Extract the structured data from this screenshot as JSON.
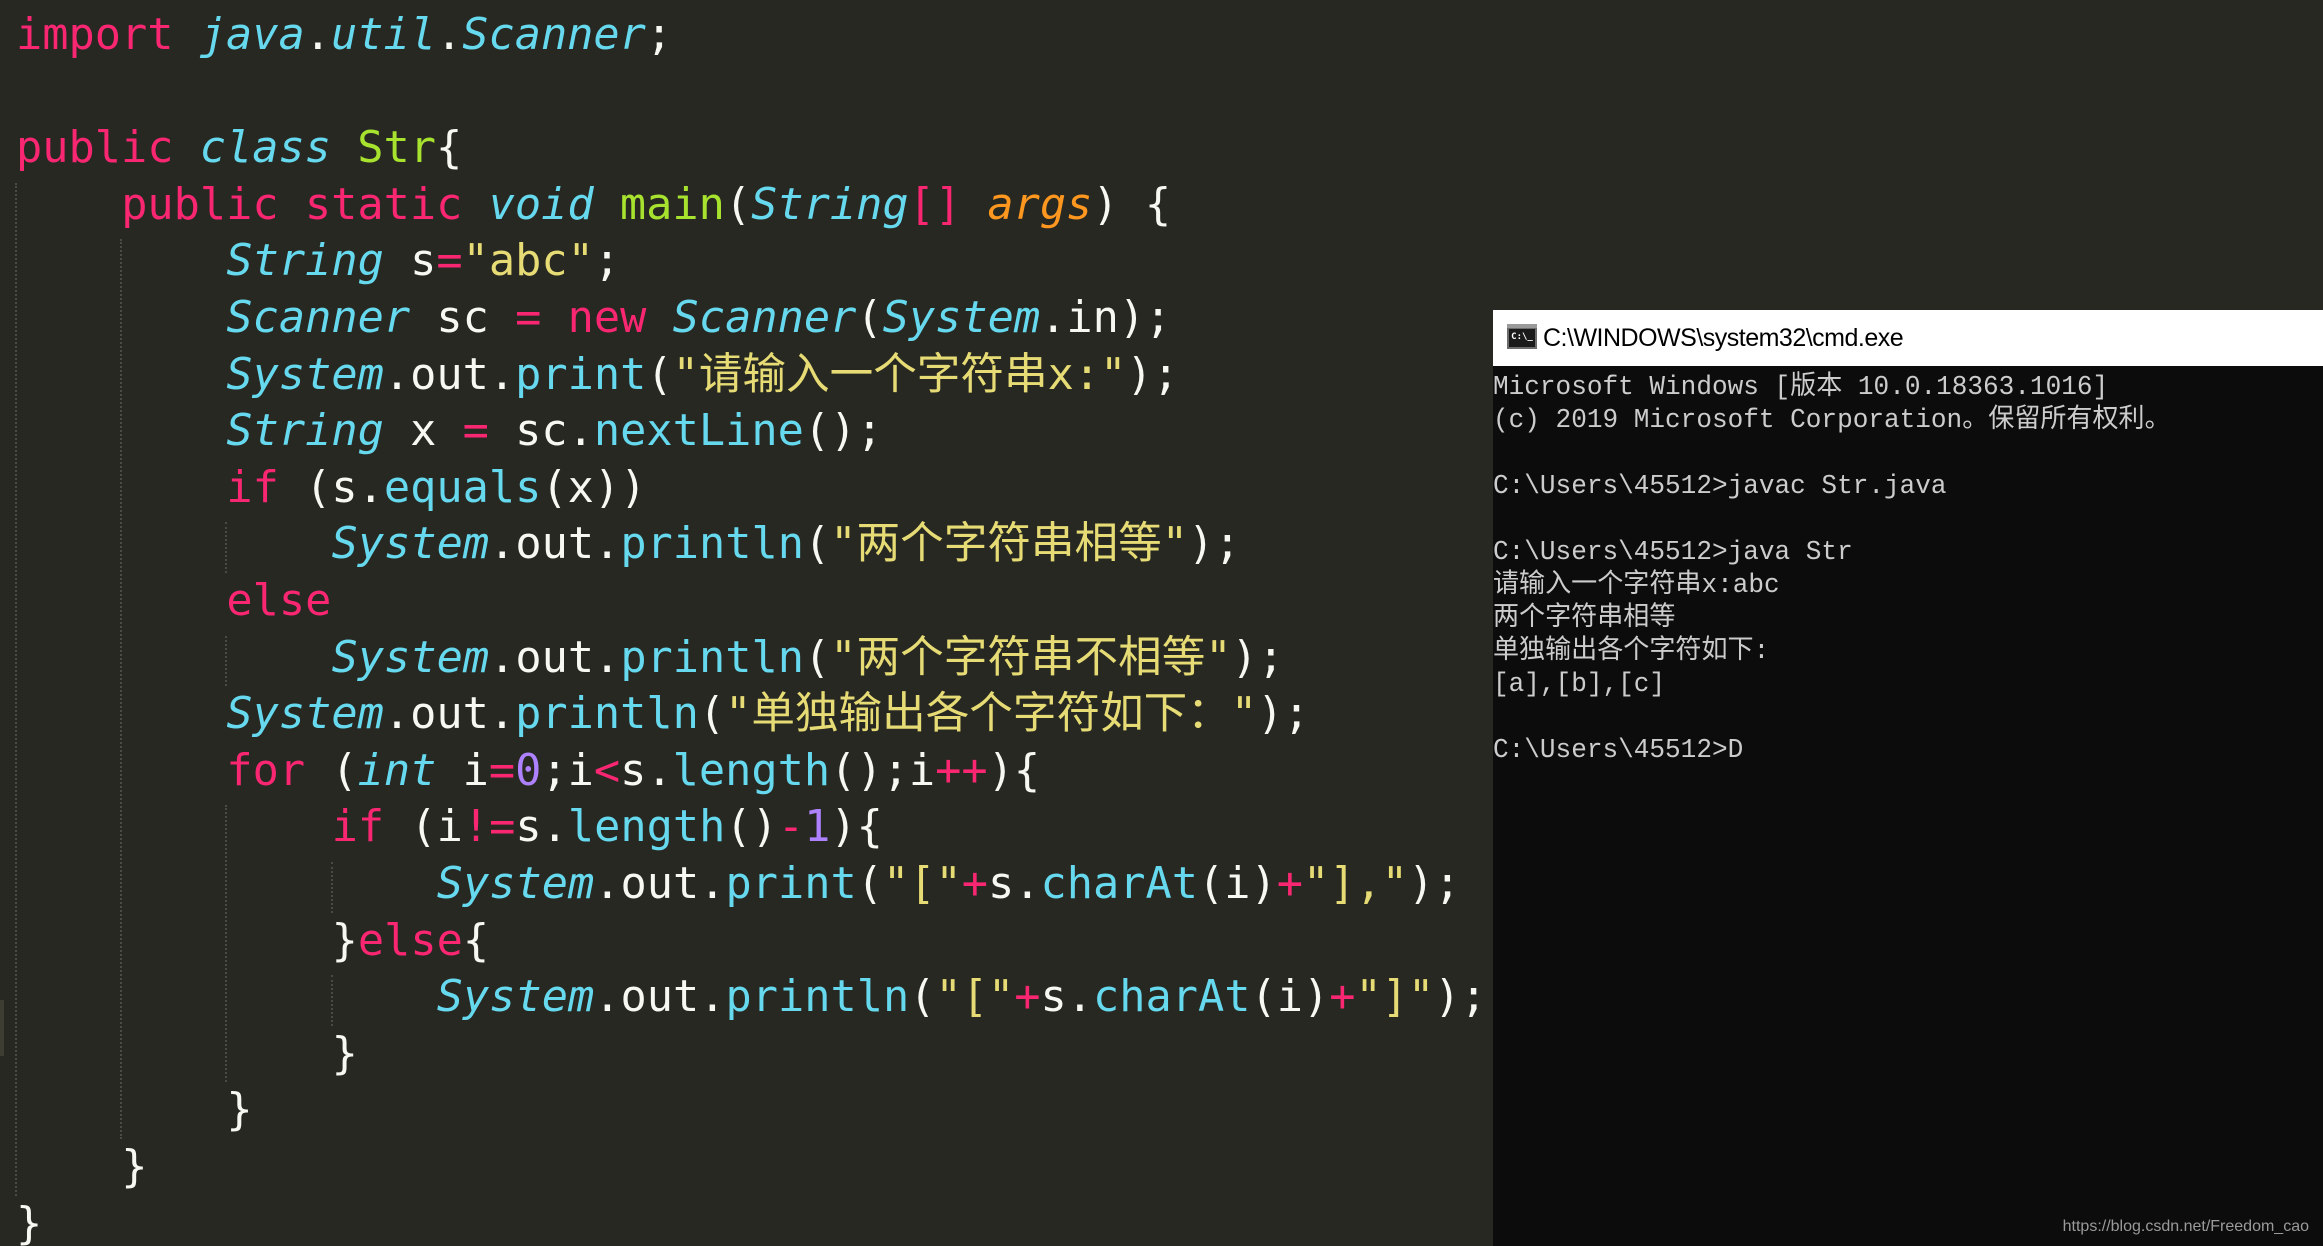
{
  "editor": {
    "theme_colors": {
      "background": "#272822",
      "keyword": "#f92672",
      "type": "#66d9ef",
      "class_name": "#a6e22e",
      "argument": "#fd971f",
      "string": "#e6db74",
      "number": "#ae81ff",
      "text": "#f8f8f2"
    },
    "lines": [
      {
        "indent": 0,
        "tokens": [
          [
            "kw",
            "import"
          ],
          [
            "plain",
            " "
          ],
          [
            "type",
            "java"
          ],
          [
            "plain",
            "."
          ],
          [
            "type",
            "util"
          ],
          [
            "plain",
            "."
          ],
          [
            "type",
            "Scanner"
          ],
          [
            "plain",
            ";"
          ]
        ]
      },
      {
        "indent": 0,
        "tokens": []
      },
      {
        "indent": 0,
        "tokens": [
          [
            "kw",
            "public"
          ],
          [
            "plain",
            " "
          ],
          [
            "type",
            "class"
          ],
          [
            "plain",
            " "
          ],
          [
            "cls",
            "Str"
          ],
          [
            "plain",
            "{"
          ]
        ]
      },
      {
        "indent": 1,
        "tokens": [
          [
            "kw",
            "public"
          ],
          [
            "plain",
            " "
          ],
          [
            "kw",
            "static"
          ],
          [
            "plain",
            " "
          ],
          [
            "type",
            "void"
          ],
          [
            "plain",
            " "
          ],
          [
            "main",
            "main"
          ],
          [
            "plain",
            "("
          ],
          [
            "type",
            "String"
          ],
          [
            "op",
            "[]"
          ],
          [
            "plain",
            " "
          ],
          [
            "arg",
            "args"
          ],
          [
            "plain",
            ") {"
          ]
        ]
      },
      {
        "indent": 2,
        "tokens": [
          [
            "type",
            "String"
          ],
          [
            "plain",
            " s"
          ],
          [
            "op",
            "="
          ],
          [
            "str",
            "\"abc\""
          ],
          [
            "plain",
            ";"
          ]
        ]
      },
      {
        "indent": 2,
        "tokens": [
          [
            "type",
            "Scanner"
          ],
          [
            "plain",
            " sc "
          ],
          [
            "op",
            "="
          ],
          [
            "plain",
            " "
          ],
          [
            "kw",
            "new"
          ],
          [
            "plain",
            " "
          ],
          [
            "type",
            "Scanner"
          ],
          [
            "plain",
            "("
          ],
          [
            "type",
            "System"
          ],
          [
            "plain",
            ".in);"
          ]
        ]
      },
      {
        "indent": 2,
        "tokens": [
          [
            "type",
            "System"
          ],
          [
            "plain",
            ".out."
          ],
          [
            "fn",
            "print"
          ],
          [
            "plain",
            "("
          ],
          [
            "str",
            "\"请输入一个字符串x:\""
          ],
          [
            "plain",
            ");"
          ]
        ]
      },
      {
        "indent": 2,
        "tokens": [
          [
            "type",
            "String"
          ],
          [
            "plain",
            " x "
          ],
          [
            "op",
            "="
          ],
          [
            "plain",
            " sc."
          ],
          [
            "fn",
            "nextLine"
          ],
          [
            "plain",
            "();"
          ]
        ]
      },
      {
        "indent": 2,
        "tokens": [
          [
            "kw",
            "if"
          ],
          [
            "plain",
            " (s."
          ],
          [
            "fn",
            "equals"
          ],
          [
            "plain",
            "(x))"
          ]
        ]
      },
      {
        "indent": 3,
        "tokens": [
          [
            "type",
            "System"
          ],
          [
            "plain",
            ".out."
          ],
          [
            "fn",
            "println"
          ],
          [
            "plain",
            "("
          ],
          [
            "str",
            "\"两个字符串相等\""
          ],
          [
            "plain",
            ");"
          ]
        ]
      },
      {
        "indent": 2,
        "tokens": [
          [
            "kw",
            "else"
          ]
        ]
      },
      {
        "indent": 3,
        "tokens": [
          [
            "type",
            "System"
          ],
          [
            "plain",
            ".out."
          ],
          [
            "fn",
            "println"
          ],
          [
            "plain",
            "("
          ],
          [
            "str",
            "\"两个字符串不相等\""
          ],
          [
            "plain",
            ");"
          ]
        ]
      },
      {
        "indent": 2,
        "tokens": [
          [
            "type",
            "System"
          ],
          [
            "plain",
            ".out."
          ],
          [
            "fn",
            "println"
          ],
          [
            "plain",
            "("
          ],
          [
            "str",
            "\"单独输出各个字符如下：\""
          ],
          [
            "plain",
            ");"
          ]
        ]
      },
      {
        "indent": 2,
        "tokens": [
          [
            "kw",
            "for"
          ],
          [
            "plain",
            " ("
          ],
          [
            "type",
            "int"
          ],
          [
            "plain",
            " i"
          ],
          [
            "op",
            "="
          ],
          [
            "num",
            "0"
          ],
          [
            "plain",
            ";i"
          ],
          [
            "op",
            "<"
          ],
          [
            "plain",
            "s."
          ],
          [
            "fn",
            "length"
          ],
          [
            "plain",
            "();i"
          ],
          [
            "op",
            "++"
          ],
          [
            "plain",
            "){"
          ]
        ]
      },
      {
        "indent": 3,
        "tokens": [
          [
            "kw",
            "if"
          ],
          [
            "plain",
            " (i"
          ],
          [
            "op",
            "!="
          ],
          [
            "plain",
            "s."
          ],
          [
            "fn",
            "length"
          ],
          [
            "plain",
            "()"
          ],
          [
            "op",
            "-"
          ],
          [
            "num",
            "1"
          ],
          [
            "plain",
            "){"
          ]
        ]
      },
      {
        "indent": 4,
        "tokens": [
          [
            "type",
            "System"
          ],
          [
            "plain",
            ".out."
          ],
          [
            "fn",
            "print"
          ],
          [
            "plain",
            "("
          ],
          [
            "str",
            "\"[\""
          ],
          [
            "op",
            "+"
          ],
          [
            "plain",
            "s."
          ],
          [
            "fn",
            "charAt"
          ],
          [
            "plain",
            "(i)"
          ],
          [
            "op",
            "+"
          ],
          [
            "str",
            "\"],\""
          ],
          [
            "plain",
            ");"
          ]
        ]
      },
      {
        "indent": 3,
        "tokens": [
          [
            "plain",
            "}"
          ],
          [
            "kw",
            "else"
          ],
          [
            "plain",
            "{"
          ]
        ]
      },
      {
        "indent": 4,
        "tokens": [
          [
            "type",
            "System"
          ],
          [
            "plain",
            ".out."
          ],
          [
            "fn",
            "println"
          ],
          [
            "plain",
            "("
          ],
          [
            "str",
            "\"[\""
          ],
          [
            "op",
            "+"
          ],
          [
            "plain",
            "s."
          ],
          [
            "fn",
            "charAt"
          ],
          [
            "plain",
            "(i)"
          ],
          [
            "op",
            "+"
          ],
          [
            "str",
            "\"]\""
          ],
          [
            "plain",
            ");"
          ]
        ]
      },
      {
        "indent": 3,
        "tokens": [
          [
            "plain",
            "}"
          ]
        ]
      },
      {
        "indent": 2,
        "tokens": [
          [
            "plain",
            "}"
          ]
        ]
      },
      {
        "indent": 1,
        "tokens": [
          [
            "plain",
            "}"
          ]
        ]
      },
      {
        "indent": 0,
        "tokens": [
          [
            "plain",
            "}"
          ]
        ]
      }
    ]
  },
  "cmd": {
    "title": "C:\\WINDOWS\\system32\\cmd.exe",
    "icon": "cmd-icon",
    "icon_text": "C:\\_",
    "background": "#0c0c0c",
    "text_color": "#cccccc",
    "lines": [
      "Microsoft Windows [版本 10.0.18363.1016]",
      "(c) 2019 Microsoft Corporation。保留所有权利。",
      "",
      "C:\\Users\\45512>javac Str.java",
      "",
      "C:\\Users\\45512>java Str",
      "请输入一个字符串x:abc",
      "两个字符串相等",
      "单独输出各个字符如下:",
      "[a],[b],[c]",
      "",
      "C:\\Users\\45512>D"
    ]
  },
  "watermark": "https://blog.csdn.net/Freedom_cao"
}
